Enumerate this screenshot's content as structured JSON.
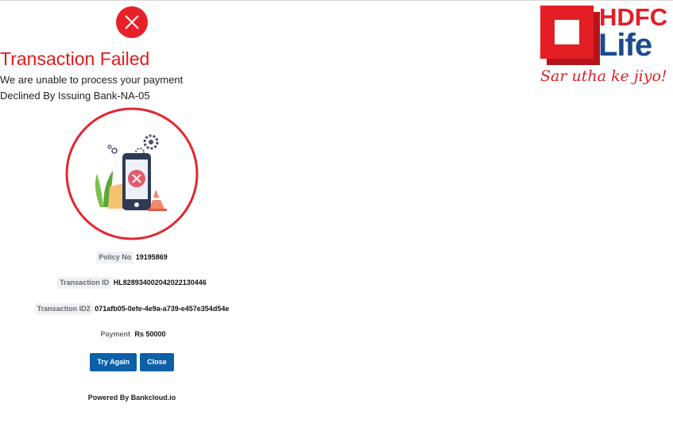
{
  "status": {
    "icon": "close-circle-icon",
    "title": "Transaction Failed",
    "message": "We are unable to process your payment",
    "reason": "Declined By Issuing Bank-NA-05",
    "illustration": "phone-failed-illustration"
  },
  "details": {
    "policy": {
      "label": "Policy No",
      "value": "19195869"
    },
    "transaction_id": {
      "label": "Transaction ID",
      "value": "HL828934002042022130446"
    },
    "transaction_id2": {
      "label": "Transaction ID2",
      "value": "071afb05-0efe-4e9a-a739-e457e354d54e"
    },
    "payment": {
      "label": "Payment",
      "value": "Rs 50000"
    }
  },
  "actions": {
    "try_again_label": "Try Again",
    "close_label": "Close"
  },
  "footer": {
    "powered_by": "Powered By Bankcloud.io"
  },
  "brand": {
    "line1": "HDFC",
    "line2": "Life",
    "tagline": "Sar utha ke jiyo!"
  },
  "colors": {
    "error_red": "#e21b1b",
    "button_blue": "#0d5fa8",
    "brand_red": "#e31e24",
    "brand_blue": "#1a4b8f"
  }
}
